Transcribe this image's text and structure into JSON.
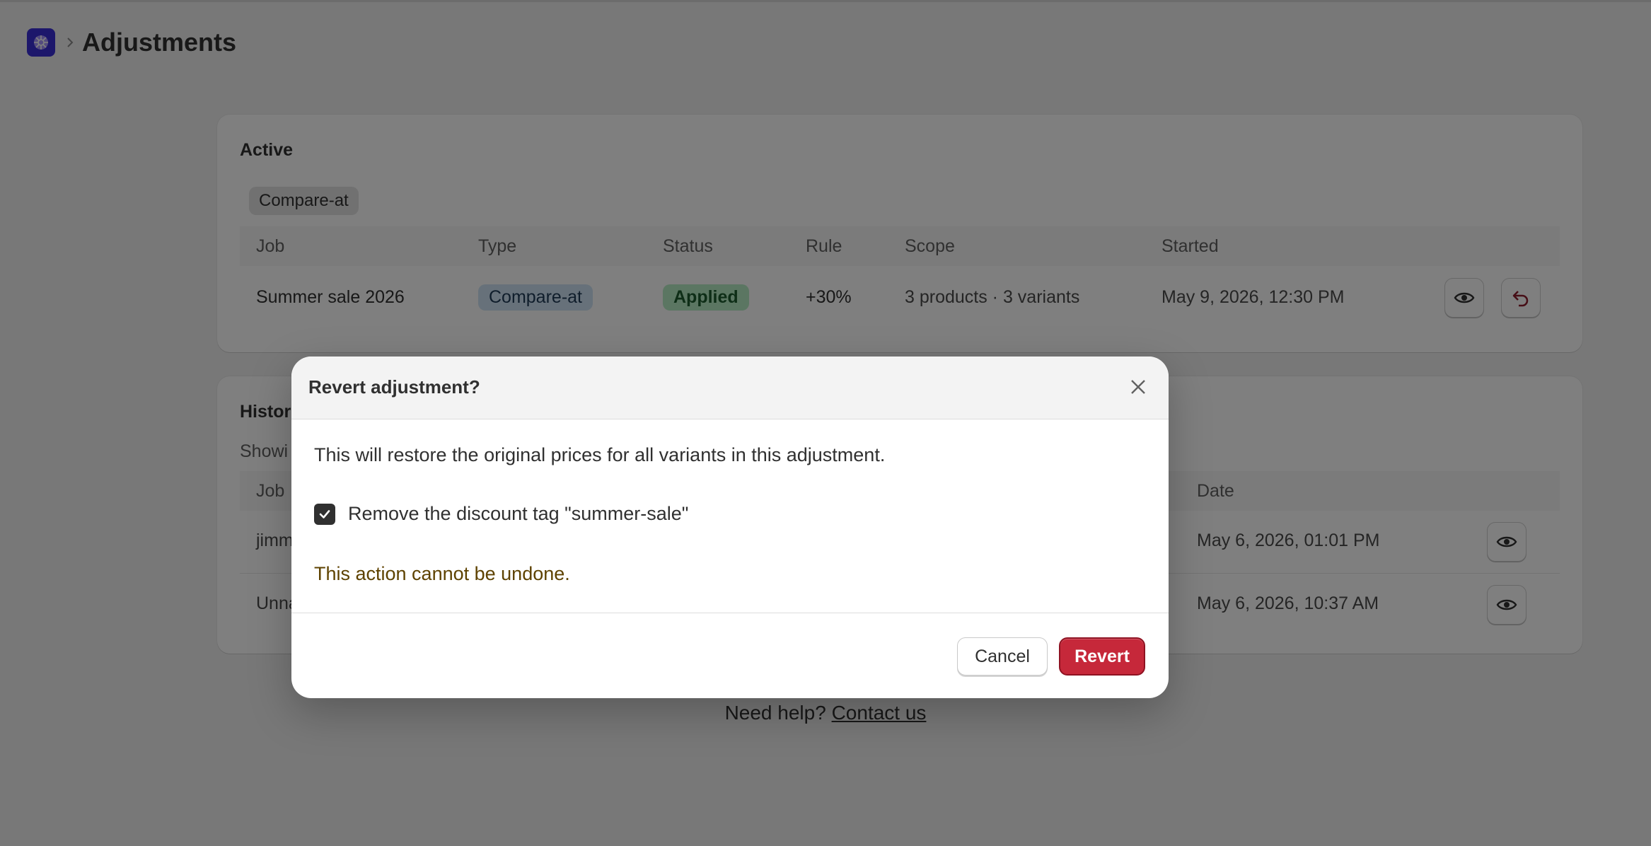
{
  "header": {
    "title": "Adjustments",
    "app_icon": "app-logo-icon",
    "breadcrumb_separator": "chevron-right-icon"
  },
  "active": {
    "title": "Active",
    "tab": "Compare-at",
    "columns": [
      "Job",
      "Type",
      "Status",
      "Rule",
      "Scope",
      "Started"
    ],
    "rows": [
      {
        "job": "Summer sale 2026",
        "type": "Compare-at",
        "status": "Applied",
        "rule": "+30%",
        "scope": "3 products · 3 variants",
        "started": "May 9, 2026, 12:30 PM",
        "actions": [
          "eye-icon",
          "revert-icon"
        ]
      }
    ]
  },
  "history": {
    "title_visible": "Histor",
    "subtitle_visible": "Showi",
    "columns": {
      "job": "Job",
      "date": "Date"
    },
    "rows": [
      {
        "job_visible": "jimm",
        "date": "May 6, 2026, 01:01 PM"
      },
      {
        "job_visible": "Unna",
        "date": "May 6, 2026, 10:37 AM"
      }
    ]
  },
  "footer": {
    "help_text": "Need help?",
    "contact_link": "Contact us"
  },
  "modal": {
    "title": "Revert adjustment?",
    "body": "This will restore the original prices for all variants in this adjustment.",
    "checkbox_label": "Remove the discount tag \"summer-sale\"",
    "checkbox_checked": true,
    "warning": "This action cannot be undone.",
    "cancel_label": "Cancel",
    "revert_label": "Revert"
  },
  "colors": {
    "page_bg": "#f1f1f1",
    "overlay": "rgba(0,0,0,0.5)",
    "revert_button": "#c6283a",
    "status_applied_bg": "#b7ecc5",
    "type_badge_bg": "#cfe3f5",
    "warning_text": "#5e4200",
    "app_icon": "#3b2fd6"
  }
}
